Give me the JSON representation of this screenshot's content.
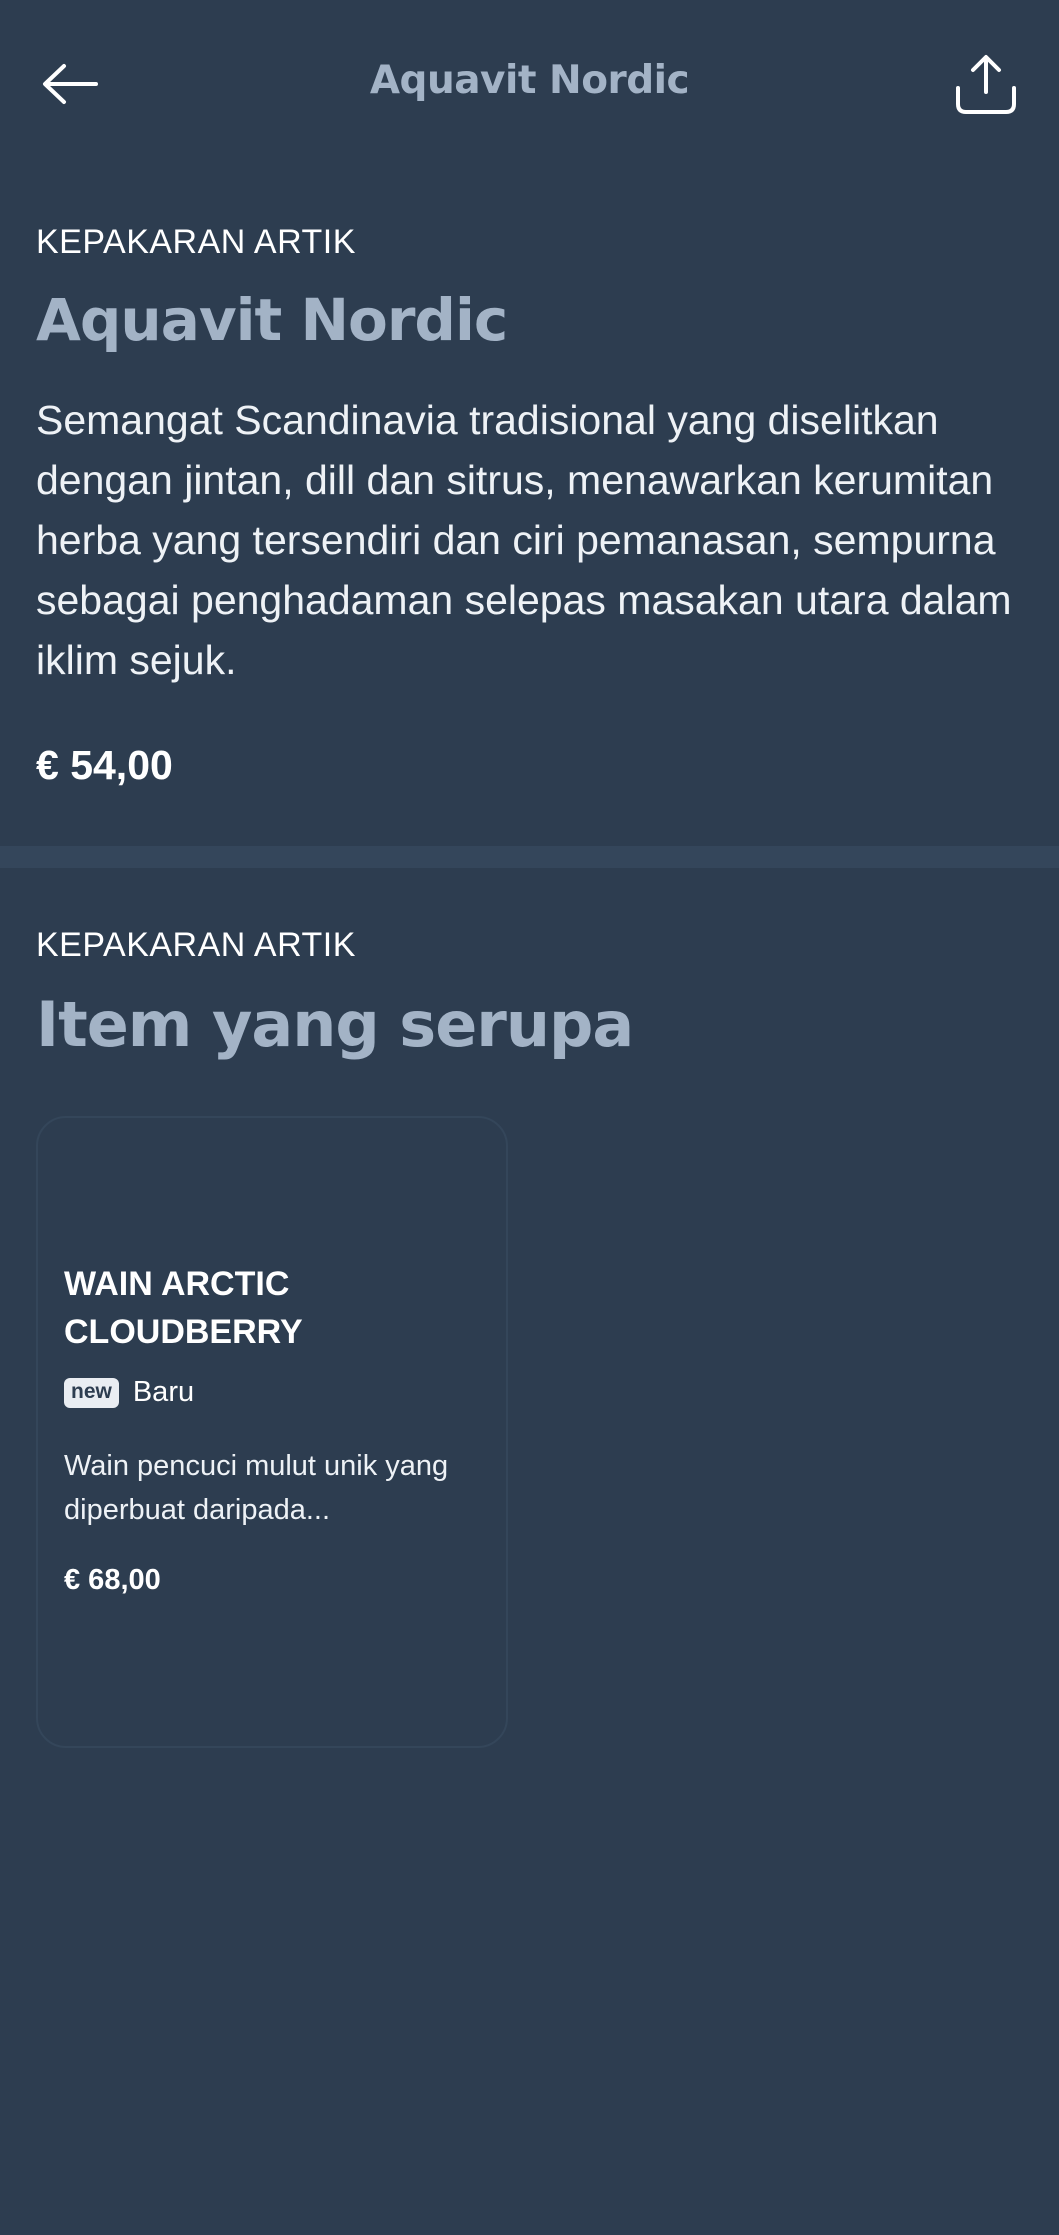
{
  "topbar": {
    "back_icon": "arrow-left-icon",
    "title": "Aquavit Nordic",
    "share_icon": "share-icon"
  },
  "product": {
    "category": "KEPAKARAN ARTIK",
    "name": "Aquavit Nordic",
    "description": "Semangat Scandinavia tradisional yang diselitkan dengan jintan, dill dan sitrus, menawarkan kerumitan herba yang tersendiri dan ciri pemanasan, sempurna sebagai penghadaman selepas masakan utara dalam iklim sejuk.",
    "price": "€ 54,00"
  },
  "similar": {
    "category": "KEPAKARAN ARTIK",
    "heading": "Item yang serupa",
    "items": [
      {
        "name": "WAIN ARCTIC CLOUDBERRY",
        "badge": "new",
        "badge_label": "Baru",
        "description": "Wain pencuci mulut unik yang diperbuat daripada...",
        "price": "€ 68,00"
      }
    ]
  },
  "colors": {
    "background": "#2d3d50",
    "title_accent": "#a3b3c6",
    "text": "#ffffff"
  }
}
